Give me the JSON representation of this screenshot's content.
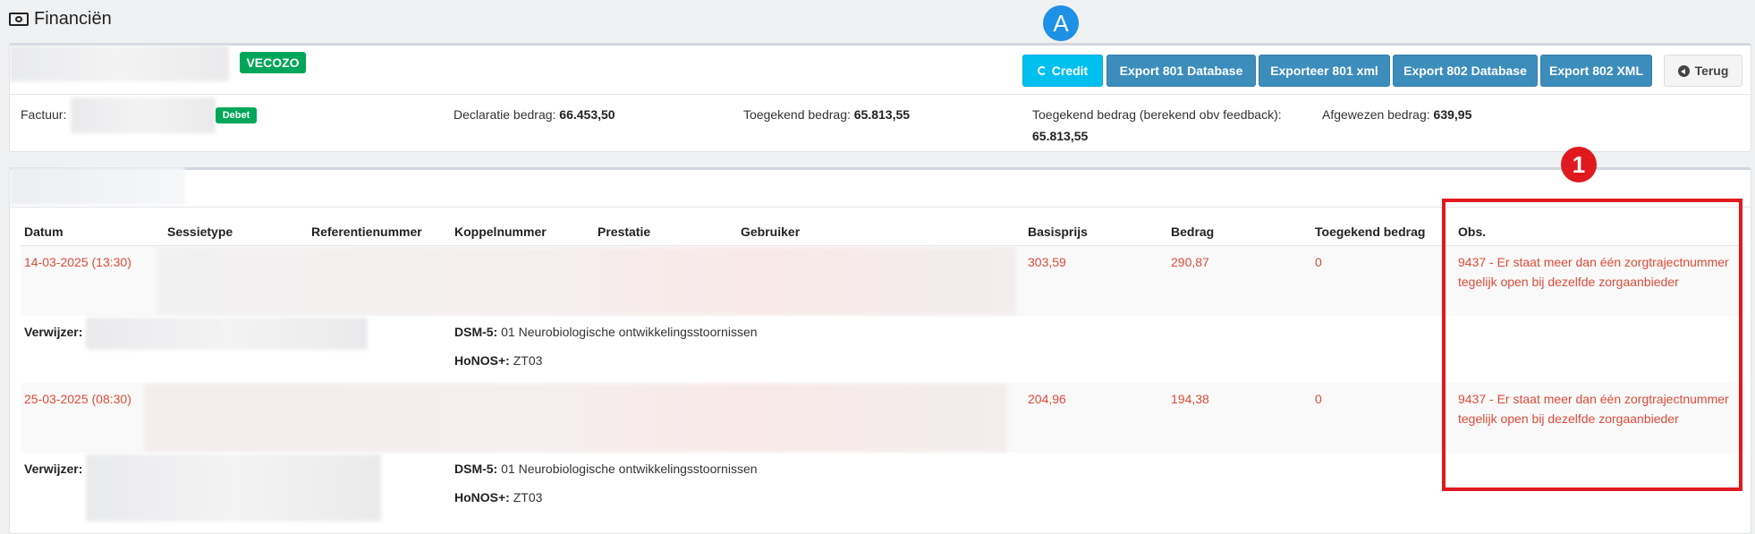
{
  "page": {
    "title": "Financiën"
  },
  "header": {
    "status_badge": "VECOZO",
    "buttons": {
      "credit": "Credit",
      "export_801_database": "Export 801 Database",
      "export_801_xml": "Exporteer 801 xml",
      "export_802_database": "Export 802 Database",
      "export_802_xml": "Export 802 XML",
      "back": "Terug"
    }
  },
  "invoice": {
    "factuur_label": "Factuur:",
    "type_badge": "Debet",
    "declaratie_label": "Declaratie bedrag:",
    "declaratie_value": "66.453,50",
    "toegekend_label": "Toegekend bedrag:",
    "toegekend_value": "65.813,55",
    "toegekend_feedback_label": "Toegekend bedrag (berekend obv feedback):",
    "toegekend_feedback_value": "65.813,55",
    "afgewezen_label": "Afgewezen bedrag:",
    "afgewezen_value": "639,95"
  },
  "table": {
    "columns": [
      "Datum",
      "Sessietype",
      "Referentienummer",
      "Koppelnummer",
      "Prestatie",
      "Gebruiker",
      "Basisprijs",
      "Bedrag",
      "Toegekend bedrag",
      "Obs."
    ],
    "rows": [
      {
        "datum": "14-03-2025 (13:30)",
        "basisprijs": "303,59",
        "bedrag": "290,87",
        "toegekend": "0",
        "obs": "9437 - Er staat meer dan één zorgtrajectnummer tegelijk open bij dezelfde zorgaanbieder",
        "verwijzer_label": "Verwijzer:",
        "dsm_label": "DSM-5:",
        "dsm_value": "01 Neurobiologische ontwikkelingsstoornissen",
        "honos_label": "HoNOS+:",
        "honos_value": "ZT03"
      },
      {
        "datum": "25-03-2025 (08:30)",
        "basisprijs": "204,96",
        "bedrag": "194,38",
        "toegekend": "0",
        "obs": "9437 - Er staat meer dan één zorgtrajectnummer tegelijk open bij dezelfde zorgaanbieder",
        "verwijzer_label": "Verwijzer:",
        "dsm_label": "DSM-5:",
        "dsm_value": "01 Neurobiologische ontwikkelingsstoornissen",
        "honos_label": "HoNOS+:",
        "honos_value": "ZT03"
      }
    ]
  },
  "annotations": {
    "callout_a": "A",
    "callout_1": "1"
  },
  "colors": {
    "accent": "#3c8dbc",
    "credit": "#00c0ef",
    "success": "#00a65a",
    "danger": "#dd4b39",
    "highlight": "#e0191e"
  }
}
